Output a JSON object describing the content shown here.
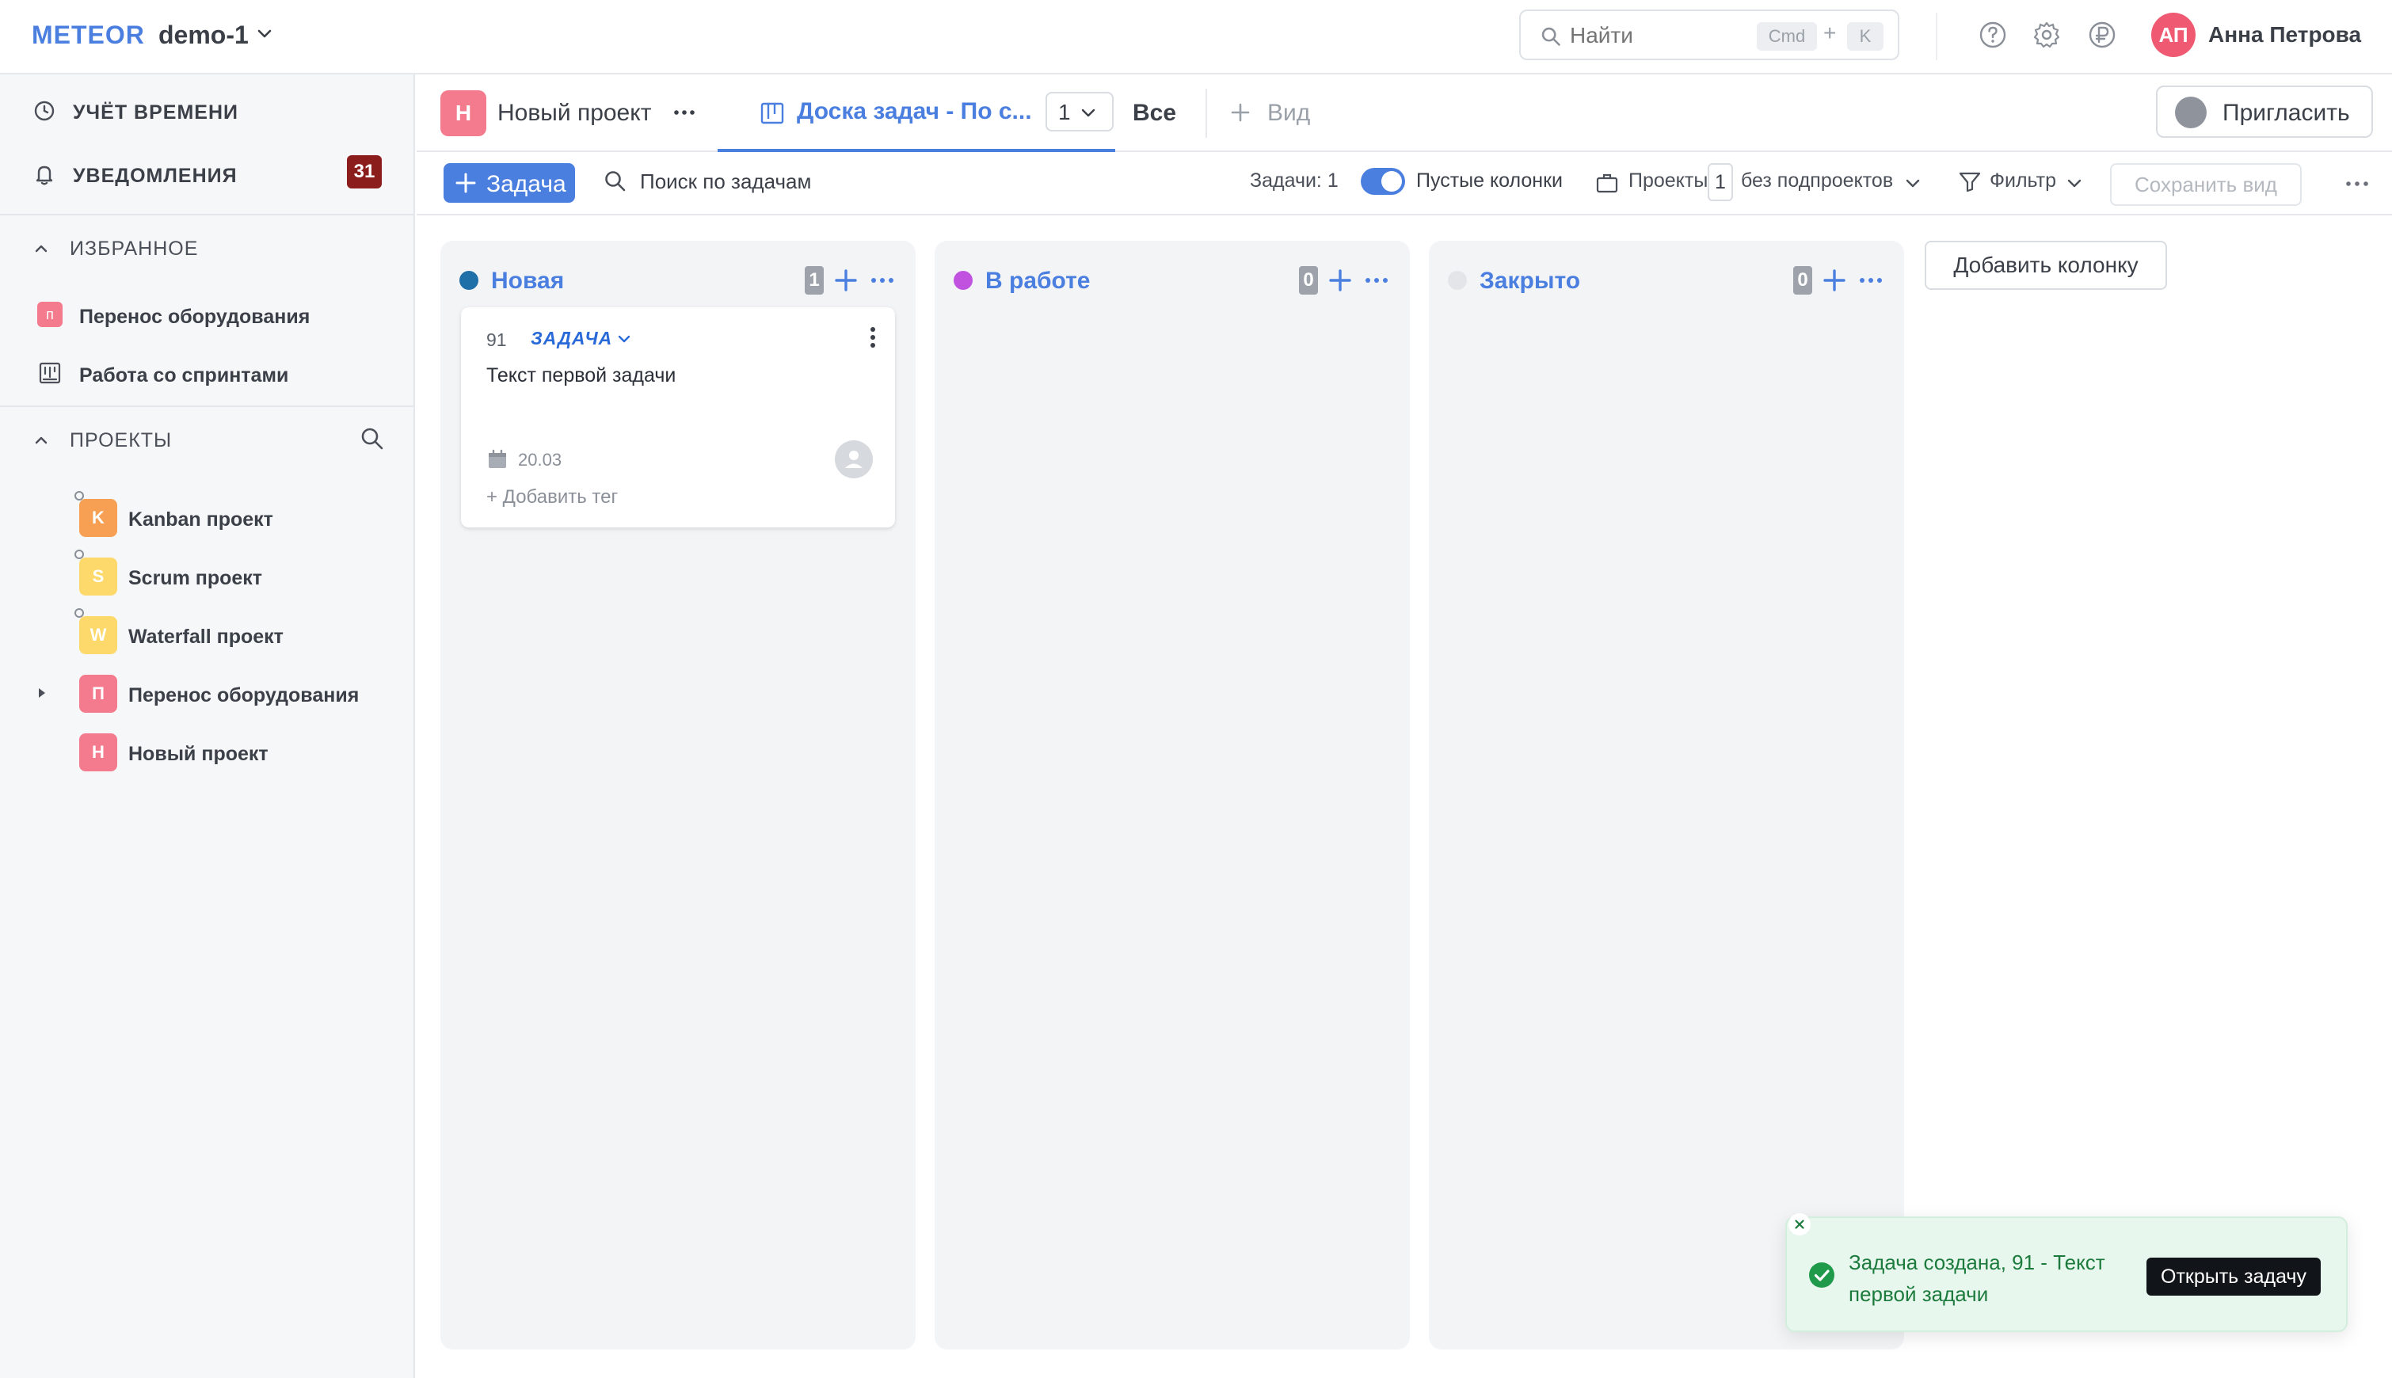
{
  "app": {
    "logo": "METEOR",
    "workspace": "demo-1"
  },
  "topbar": {
    "search_placeholder": "Найти",
    "shortcut_cmd": "Cmd",
    "shortcut_plus": "+",
    "shortcut_key": "K",
    "icons": [
      "help-icon",
      "settings-icon",
      "currency-ruble-icon"
    ],
    "user_initials": "АП",
    "user_name": "Анна Петрова",
    "avatar_color": "#ef5a72"
  },
  "sidebar": {
    "time_tracking": "УЧЁТ ВРЕМЕНИ",
    "notifications": "УВЕДОМЛЕНИЯ",
    "notifications_count": "31",
    "favorites_header": "ИЗБРАННОЕ",
    "favorites": [
      {
        "icon_letter": "п",
        "label": "Перенос оборудования"
      },
      {
        "icon": "board-icon",
        "label": "Работа со спринтами"
      }
    ],
    "projects_header": "ПРОЕКТЫ",
    "projects": [
      {
        "letter": "K",
        "label": "Kanban проект",
        "color": "#f7a054"
      },
      {
        "letter": "S",
        "label": "Scrum проект",
        "color": "#fcd96a"
      },
      {
        "letter": "W",
        "label": "Waterfall проект",
        "color": "#fcd96a"
      },
      {
        "letter": "П",
        "label": "Перенос оборудования",
        "color": "#f47a8d"
      },
      {
        "letter": "Н",
        "label": "Новый проект",
        "color": "#f47a8d"
      }
    ]
  },
  "tabs": {
    "project_letter": "Н",
    "project_name": "Новый проект",
    "board_tab": "Доска задач - По с...",
    "board_count": "1",
    "all_tab": "Все",
    "view_tab": "Вид",
    "invite": "Пригласить"
  },
  "toolbar": {
    "add_task": "Задача",
    "search_placeholder": "Поиск по задачам",
    "tasks_count": "Задачи: 1",
    "empty_columns": "Пустые колонки",
    "projects_label": "Проекты",
    "projects_num": "1",
    "subprojects": "без подпроектов",
    "filter": "Фильтр",
    "save_view": "Сохранить вид"
  },
  "board": {
    "columns": [
      {
        "title": "Новая",
        "count": "1",
        "dot_color": "#1f6fa8"
      },
      {
        "title": "В работе",
        "count": "0",
        "dot_color": "#c152e0"
      },
      {
        "title": "Закрыто",
        "count": "0",
        "dot_color": "#e3e5e8"
      }
    ],
    "add_column": "Добавить колонку",
    "card": {
      "id": "91",
      "type": "ЗАДАЧА",
      "title": "Текст первой задачи",
      "date": "20.03",
      "add_tag": "+ Добавить тег"
    }
  },
  "toast": {
    "message": "Задача создана, 91 - Текст первой задачи",
    "action": "Открыть задачу"
  }
}
